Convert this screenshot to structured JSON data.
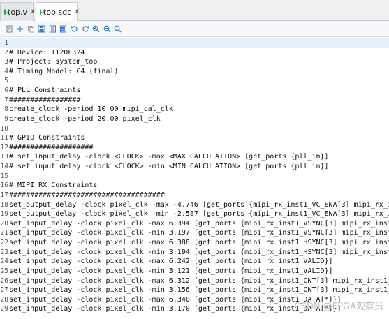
{
  "tabs": [
    {
      "label": "top.v",
      "close": "✕",
      "status_icon": "check-circle-icon",
      "active": false
    },
    {
      "label": "top.sdc",
      "close": "✕",
      "status_icon": "check-circle-icon",
      "active": true
    }
  ],
  "toolbar": {
    "icons": [
      "page-icon",
      "add-icon",
      "copy-icon",
      "save-icon",
      "import-icon",
      "export-icon",
      "undo-icon",
      "redo-icon",
      "zoom-in-icon",
      "zoom-out-icon",
      "zoom-fit-icon"
    ]
  },
  "colors": {
    "accent_green": "#2e9d3e",
    "current_line": "#e6f0fb",
    "text": "#111111"
  },
  "editor": {
    "lines": [
      {
        "n": "1",
        "text": ""
      },
      {
        "n": "2",
        "text": "# Device: T120F324"
      },
      {
        "n": "3",
        "text": "# Project: system_top"
      },
      {
        "n": "4",
        "text": "# Timing Model: C4 (final)"
      },
      {
        "n": "5",
        "text": ""
      },
      {
        "n": "6",
        "text": "# PLL Constraints"
      },
      {
        "n": "7",
        "text": "#################"
      },
      {
        "n": "8",
        "text": "create_clock -period 10.00 mipi_cal_clk"
      },
      {
        "n": "9",
        "text": "create_clock -period 20.00 pixel_clk"
      },
      {
        "n": "10",
        "text": ""
      },
      {
        "n": "11",
        "text": "# GPIO Constraints"
      },
      {
        "n": "12",
        "text": "####################"
      },
      {
        "n": "13",
        "text": "# set_input_delay -clock <CLOCK> -max <MAX CALCULATION> [get_ports {pll_in}]"
      },
      {
        "n": "14",
        "text": "# set_input_delay -clock <CLOCK> -min <MIN CALCULATION> [get_ports {pll_in}]"
      },
      {
        "n": "15",
        "text": ""
      },
      {
        "n": "16",
        "text": "# MIPI RX Constraints"
      },
      {
        "n": "17",
        "text": "#####################################"
      },
      {
        "n": "18",
        "text": "set_output_delay -clock pixel_clk -max -4.746 [get_ports {mipi_rx_inst1_VC_ENA[3] mipi_rx_inst1_VC_ENA[2] mi"
      },
      {
        "n": "19",
        "text": "set_output_delay -clock pixel_clk -min -2.587 [get_ports {mipi_rx_inst1_VC_ENA[3] mipi_rx_inst1_VC_ENA[2] mi"
      },
      {
        "n": "20",
        "text": "set_input_delay -clock pixel_clk -max 6.394 [get_ports {mipi_rx_inst1_VSYNC[3] mipi_rx_inst1_VSYNC[2] mipi_"
      },
      {
        "n": "21",
        "text": "set_input_delay -clock pixel_clk -min 3.197 [get_ports {mipi_rx_inst1_VSYNC[3] mipi_rx_inst1_VSYNC[2] mipi_"
      },
      {
        "n": "22",
        "text": "set_input_delay -clock pixel_clk -max 6.388 [get_ports {mipi_rx_inst1_HSYNC[3] mipi_rx_inst1_HSYNC[2] mipi_"
      },
      {
        "n": "23",
        "text": "set_input_delay -clock pixel_clk -min 3.194 [get_ports {mipi_rx_inst1_HSYNC[3] mipi_rx_inst1_HSYNC[2] mipi_"
      },
      {
        "n": "24",
        "text": "set_input_delay -clock pixel_clk -max 6.242 [get_ports {mipi_rx_inst1_VALID}]"
      },
      {
        "n": "25",
        "text": "set_input_delay -clock pixel_clk -min 3.121 [get_ports {mipi_rx_inst1_VALID}]"
      },
      {
        "n": "26",
        "text": "set_input_delay -clock pixel_clk -max 6.312 [get_ports {mipi_rx_inst1_CNT[3] mipi_rx_inst1_CNT[2] mipi_rx_i"
      },
      {
        "n": "27",
        "text": "set_input_delay -clock pixel_clk -min 3.156 [get_ports {mipi_rx_inst1_CNT[3] mipi_rx_inst1_CNT[2] mipi_rx_i"
      },
      {
        "n": "28",
        "text": "set_input_delay -clock pixel_clk -max 6.340 [get_ports {mipi_rx_inst1_DATA[*]}]"
      },
      {
        "n": "29",
        "text": "set_input_delay -clock pixel_clk -min 3.170 [get_ports {mipi_rx_inst1_DATA[*]}]"
      }
    ]
  },
  "watermark": "CSDN @FPGA观察员"
}
